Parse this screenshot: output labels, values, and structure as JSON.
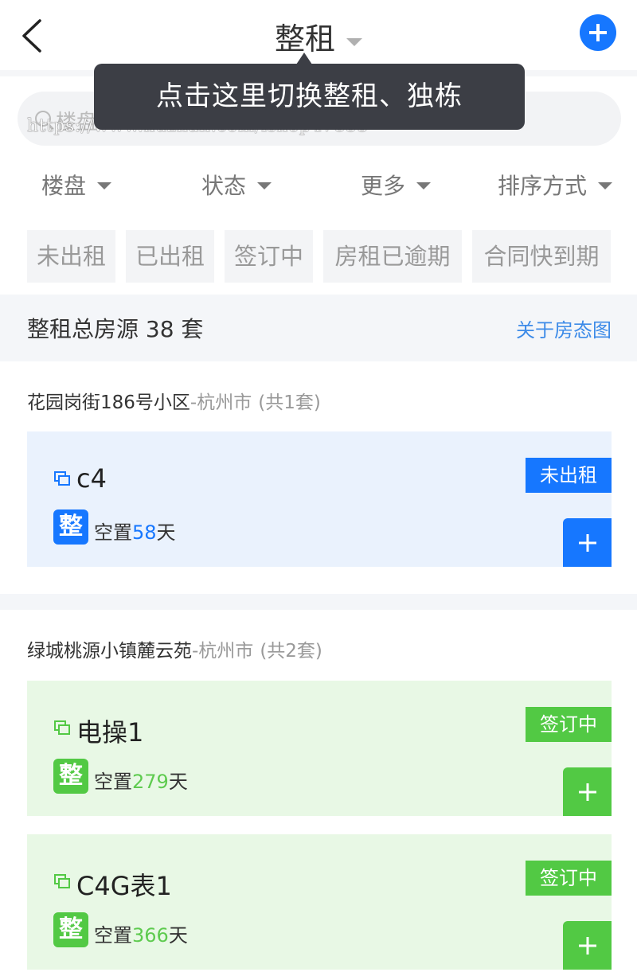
{
  "header": {
    "title": "整租"
  },
  "tooltip": {
    "text": "点击这里切换整租、独栋"
  },
  "search": {
    "placeholder": "楼盘"
  },
  "watermark": "https://www.huzhan.com/ishop47855",
  "filters": [
    "楼盘",
    "状态",
    "更多",
    "排序方式"
  ],
  "chips": [
    "未出租",
    "已出租",
    "签订中",
    "房租已逾期",
    "合同快到期"
  ],
  "summary": {
    "text": "整租总房源 38 套",
    "link": "关于房态图"
  },
  "groups": [
    {
      "name": "花园岗街186号小区",
      "city": "-杭州市",
      "count": "(共1套)",
      "units": [
        {
          "name": "c4",
          "type_badge": "整",
          "vacancy_prefix": "空置",
          "vacancy_days": "58",
          "vacancy_suffix": "天",
          "status": "未出租"
        }
      ]
    },
    {
      "name": "绿城桃源小镇麓云苑",
      "city": "-杭州市",
      "count": "(共2套)",
      "units": [
        {
          "name": "电操1",
          "type_badge": "整",
          "vacancy_prefix": "空置",
          "vacancy_days": "279",
          "vacancy_suffix": "天",
          "status": "签订中"
        },
        {
          "name": "C4G表1",
          "type_badge": "整",
          "vacancy_prefix": "空置",
          "vacancy_days": "366",
          "vacancy_suffix": "天",
          "status": "签订中"
        }
      ]
    }
  ],
  "colors": {
    "primary_blue": "#1677ff",
    "status_green": "#52c944",
    "tooltip_bg": "#3c3e45",
    "link_blue": "#3d8be8"
  },
  "icons": {
    "back": "chevron-left-icon",
    "add": "plus-circle-icon",
    "search": "search-icon",
    "unit": "copy-icon"
  }
}
